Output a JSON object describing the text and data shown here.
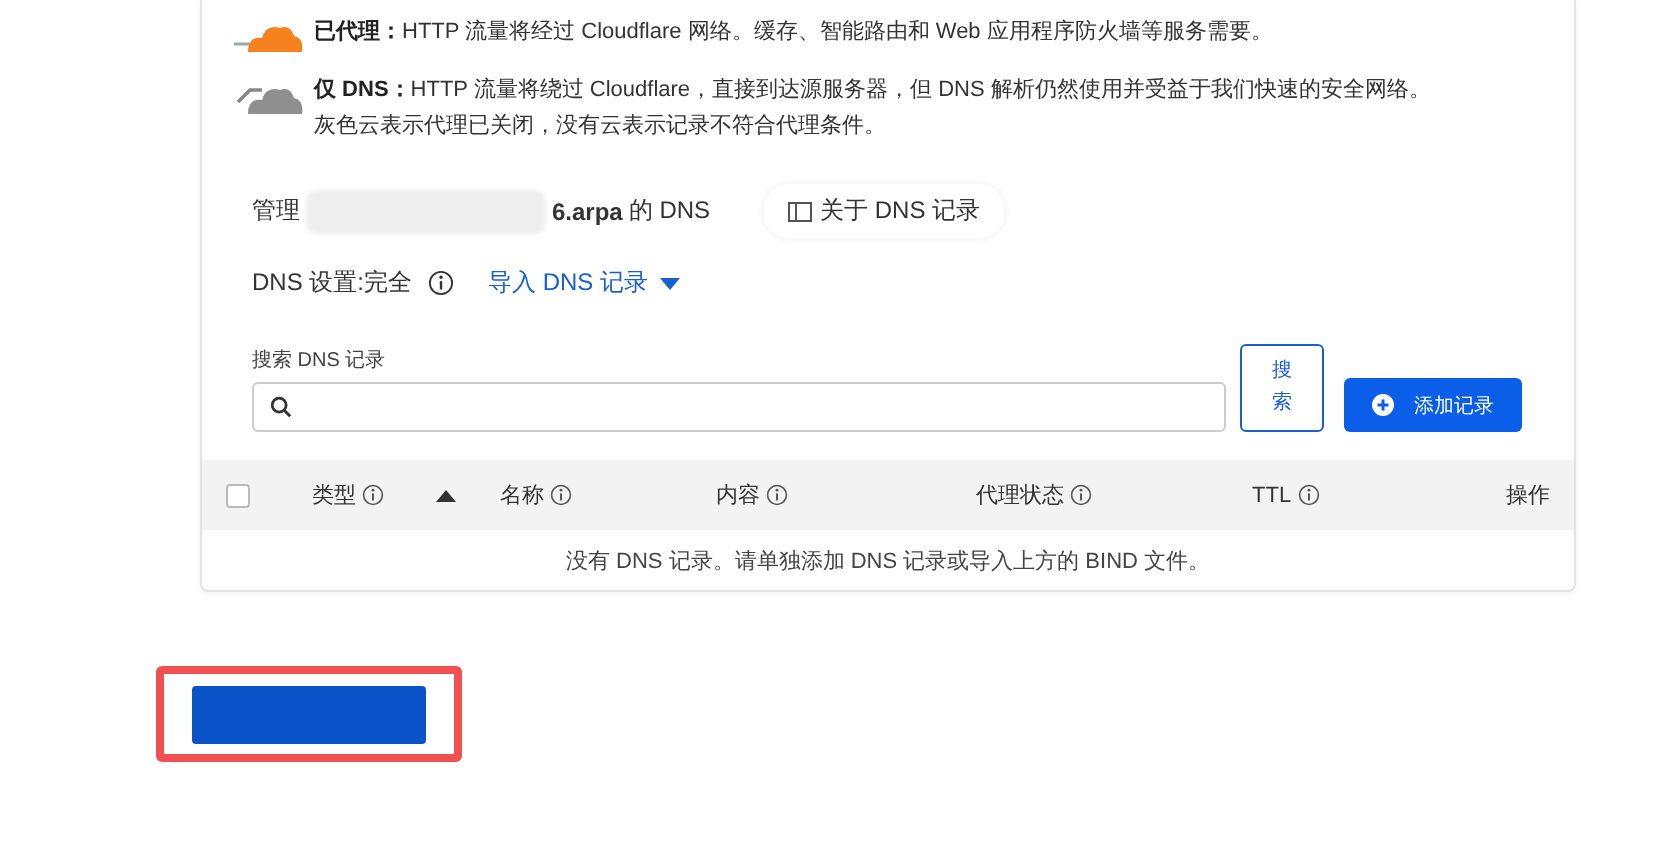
{
  "proxy_modes": [
    {
      "kind": "proxied",
      "label": "已代理：",
      "text": "HTTP 流量将经过 Cloudflare 网络。缓存、智能路由和 Web 应用程序防火墙等服务需要。"
    },
    {
      "kind": "dns_only",
      "label": "仅 DNS：",
      "text": "HTTP 流量将绕过 Cloudflare，直接到达源服务器，但 DNS 解析仍然使用并受益于我们快速的安全网络。",
      "note": "灰色云表示代理已关闭，没有云表示记录不符合代理条件。"
    }
  ],
  "manage": {
    "prefix": "管理",
    "domain": "6.arpa",
    "suffix": "的 DNS",
    "about_button": "关于 DNS 记录"
  },
  "dns_setup": {
    "label": "DNS 设置:完全",
    "import_link": "导入 DNS 记录"
  },
  "search": {
    "label": "搜索 DNS 记录",
    "search_button": "搜索",
    "add_button": "添加记录"
  },
  "table": {
    "select_all": {
      "checked": false
    },
    "columns": [
      {
        "label": "类型",
        "info": true,
        "sorted": true
      },
      {
        "label": "名称",
        "info": true,
        "sorted": false
      },
      {
        "label": "内容",
        "info": true,
        "sorted": false
      },
      {
        "label": "代理状态",
        "info": true,
        "sorted": false
      },
      {
        "label": "TTL",
        "info": true,
        "sorted": false
      },
      {
        "label": "操作",
        "info": false,
        "sorted": false
      }
    ],
    "empty_message": "没有 DNS 记录。请单独添加 DNS 记录或导入上方的 BIND 文件。"
  },
  "bottom_button": {
    "highlighted": true
  }
}
